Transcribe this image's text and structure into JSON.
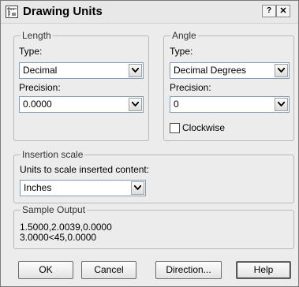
{
  "window": {
    "title": "Drawing Units",
    "help_glyph": "?",
    "close_glyph": "✕"
  },
  "length": {
    "legend": "Length",
    "type_label": "Type:",
    "type_value": "Decimal",
    "precision_label": "Precision:",
    "precision_value": "0.0000"
  },
  "angle": {
    "legend": "Angle",
    "type_label": "Type:",
    "type_value": "Decimal Degrees",
    "precision_label": "Precision:",
    "precision_value": "0",
    "clockwise_label": "Clockwise",
    "clockwise_checked": false
  },
  "insertion": {
    "legend": "Insertion scale",
    "label": "Units to scale inserted content:",
    "value": "Inches"
  },
  "sample": {
    "legend": "Sample Output",
    "line1": "1.5000,2.0039,0.0000",
    "line2": "3.0000<45,0.0000"
  },
  "buttons": {
    "ok": "OK",
    "cancel": "Cancel",
    "direction": "Direction...",
    "help": "Help"
  }
}
